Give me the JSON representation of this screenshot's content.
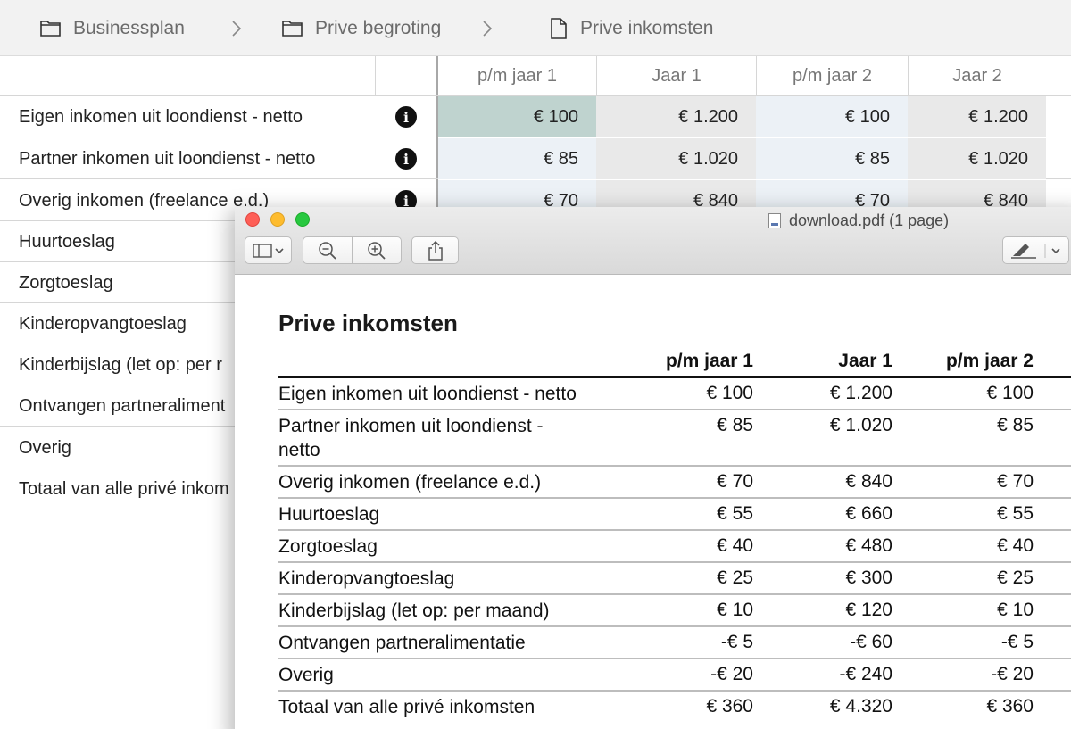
{
  "breadcrumb": {
    "items": [
      {
        "label": "Businessplan",
        "icon": "folder-icon"
      },
      {
        "label": "Prive begroting",
        "icon": "folder-icon"
      },
      {
        "label": "Prive inkomsten",
        "icon": "document-icon"
      }
    ]
  },
  "sheet": {
    "columns": [
      "p/m jaar 1",
      "Jaar 1",
      "p/m jaar 2",
      "Jaar 2"
    ],
    "rows": [
      {
        "label": "Eigen inkomen uit loondienst - netto",
        "values": [
          "€ 100",
          "€ 1.200",
          "€ 100",
          "€ 1.200"
        ]
      },
      {
        "label": "Partner inkomen uit loondienst - netto",
        "values": [
          "€ 85",
          "€ 1.020",
          "€ 85",
          "€ 1.020"
        ]
      },
      {
        "label": "Overig inkomen (freelance e.d.)",
        "values": [
          "€ 70",
          "€ 840",
          "€ 70",
          "€ 840"
        ]
      },
      {
        "label": "Huurtoeslag"
      },
      {
        "label": "Zorgtoeslag"
      },
      {
        "label": "Kinderopvangtoeslag"
      },
      {
        "label": "Kinderbijslag (let op: per r"
      },
      {
        "label": "Ontvangen partneraliment"
      },
      {
        "label": "Overig"
      },
      {
        "label": "Totaal van alle privé inkom"
      }
    ]
  },
  "preview": {
    "title": "download.pdf (1 page)",
    "toolbar": {
      "sidebar": "sidebar-toggle-icon",
      "zoom_out": "zoom-out-icon",
      "zoom_in": "zoom-in-icon",
      "share": "share-icon",
      "markup": "markup-pen-icon"
    },
    "document": {
      "title": "Prive inkomsten",
      "columns": [
        "p/m jaar 1",
        "Jaar 1",
        "p/m jaar 2"
      ],
      "rows": [
        {
          "label": "Eigen inkomen uit loondienst - netto",
          "values": [
            "€ 100",
            "€ 1.200",
            "€ 100"
          ]
        },
        {
          "label_line1": "Partner inkomen uit loondienst -",
          "label_line2": "netto",
          "values": [
            "€ 85",
            "€ 1.020",
            "€ 85"
          ]
        },
        {
          "label": "Overig inkomen (freelance e.d.)",
          "values": [
            "€ 70",
            "€ 840",
            "€ 70"
          ]
        },
        {
          "label": "Huurtoeslag",
          "values": [
            "€ 55",
            "€ 660",
            "€ 55"
          ]
        },
        {
          "label": "Zorgtoeslag",
          "values": [
            "€ 40",
            "€ 480",
            "€ 40"
          ]
        },
        {
          "label": "Kinderopvangtoeslag",
          "values": [
            "€ 25",
            "€ 300",
            "€ 25"
          ]
        },
        {
          "label": "Kinderbijslag (let op: per maand)",
          "values": [
            "€ 10",
            "€ 120",
            "€ 10"
          ]
        },
        {
          "label": "Ontvangen partneralimentatie",
          "values": [
            "-€ 5",
            "-€ 60",
            "-€ 5"
          ]
        },
        {
          "label": "Overig",
          "values": [
            "-€ 20",
            "-€ 240",
            "-€ 20"
          ]
        },
        {
          "label": "Totaal van alle privé inkomsten",
          "values": [
            "€ 360",
            "€ 4.320",
            "€ 360"
          ]
        }
      ]
    }
  },
  "colors": {
    "selected_cell": "#bfd3cf",
    "blue_column": "#ecf1f6",
    "gray_column": "#e9e9e9",
    "traffic_red": "#fe5f57",
    "traffic_yellow": "#febc2e",
    "traffic_green": "#28c840"
  }
}
